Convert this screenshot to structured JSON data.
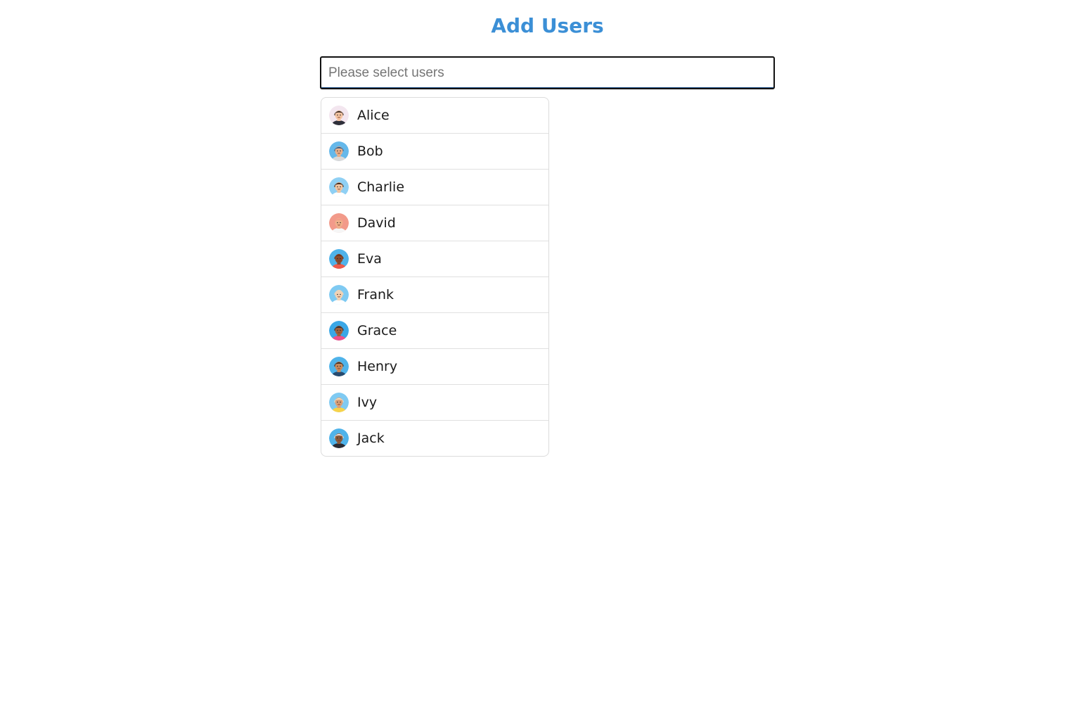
{
  "header": {
    "title": "Add Users"
  },
  "search": {
    "placeholder": "Please select users",
    "value": ""
  },
  "users": [
    {
      "name": "Alice",
      "avatar": "avatar-icon",
      "bg": "#f3e6ef",
      "skin": "#f4c3a2",
      "hair": "#3a2a24",
      "shirt": "#2f2f3a"
    },
    {
      "name": "Bob",
      "avatar": "avatar-icon",
      "bg": "#65b8ea",
      "skin": "#e8b08b",
      "hair": "#2e5f8e",
      "shirt": "#d9d9d9"
    },
    {
      "name": "Charlie",
      "avatar": "avatar-icon",
      "bg": "#8fd0f4",
      "skin": "#f1c4a0",
      "hair": "#3b2418",
      "shirt": "#ffffff"
    },
    {
      "name": "David",
      "avatar": "avatar-icon",
      "bg": "#f29a8a",
      "skin": "#f0b08a",
      "hair": "#f29a8a",
      "shirt": "#f6f6f6"
    },
    {
      "name": "Eva",
      "avatar": "avatar-icon",
      "bg": "#4fb3ea",
      "skin": "#8a4a2c",
      "hair": "#6b3620",
      "shirt": "#ee5a4a"
    },
    {
      "name": "Frank",
      "avatar": "avatar-icon",
      "bg": "#7fcaf2",
      "skin": "#f2d2b4",
      "hair": "#e8d4bc",
      "shirt": "#ffffff"
    },
    {
      "name": "Grace",
      "avatar": "avatar-icon",
      "bg": "#3aa7e6",
      "skin": "#a0603a",
      "hair": "#2d2d36",
      "shirt": "#ee4f8a"
    },
    {
      "name": "Henry",
      "avatar": "avatar-icon",
      "bg": "#4fb3ea",
      "skin": "#c98a5c",
      "hair": "#3a2a22",
      "shirt": "#274a6e"
    },
    {
      "name": "Ivy",
      "avatar": "avatar-icon",
      "bg": "#7fcaf2",
      "skin": "#d9a07a",
      "hair": "#efe1c8",
      "shirt": "#f7d34a"
    },
    {
      "name": "Jack",
      "avatar": "avatar-icon",
      "bg": "#4fb3ea",
      "skin": "#8a5a3c",
      "hair": "#e8e8e8",
      "shirt": "#2b2b33"
    }
  ]
}
